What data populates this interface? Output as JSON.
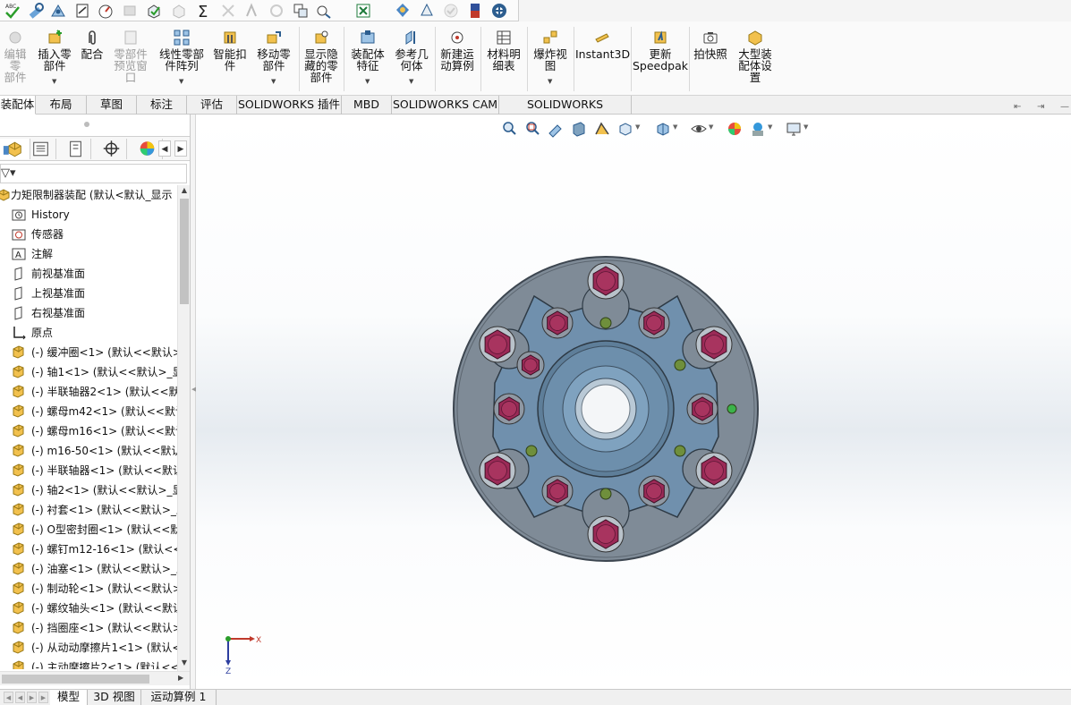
{
  "quick_access": {
    "icons": [
      "spell-check-icon",
      "measure-icon",
      "mass-properties-icon",
      "section-icon",
      "performance-icon",
      "disabled-icon",
      "check-icon",
      "disabled-icon-2",
      "sum-icon",
      "disabled-icon-3",
      "disabled-icon-4",
      "disabled-icon-5",
      "replace-icon",
      "sensor-icon",
      "excel-icon",
      "render-icon",
      "render-icon-2",
      "disabled-check-icon",
      "material-icon",
      "options-icon"
    ]
  },
  "ribbon": {
    "buttons": [
      {
        "id": "edit-component",
        "label": "编辑零\n部件",
        "disabled": true
      },
      {
        "id": "insert-component",
        "label": "插入零\n部件",
        "dropdown": true
      },
      {
        "id": "mate",
        "label": "配合"
      },
      {
        "id": "component-preview",
        "label": "零部件\n预览窗\n口",
        "disabled": true
      },
      {
        "id": "linear-pattern",
        "label": "线性零部\n件阵列",
        "dropdown": true
      },
      {
        "id": "smart-fastener",
        "label": "智能扣\n件"
      },
      {
        "id": "move-component",
        "label": "移动零\n部件",
        "dropdown": true
      },
      {
        "id": "show-hidden",
        "label": "显示隐\n藏的零\n部件"
      },
      {
        "id": "assembly-feature",
        "label": "装配体\n特征",
        "dropdown": true
      },
      {
        "id": "reference-geometry",
        "label": "参考几\n何体",
        "dropdown": true
      },
      {
        "id": "new-motion-study",
        "label": "新建运\n动算例"
      },
      {
        "id": "bom",
        "label": "材料明\n细表"
      },
      {
        "id": "exploded-view",
        "label": "爆炸视\n图",
        "dropdown": true
      },
      {
        "id": "instant3d",
        "label": "Instant3D"
      },
      {
        "id": "update-speedpak",
        "label": "更新\nSpeedpak"
      },
      {
        "id": "snapshot",
        "label": "拍快照"
      },
      {
        "id": "large-assembly",
        "label": "大型装\n配体设\n置"
      }
    ]
  },
  "tabs": [
    "装配体",
    "布局",
    "草图",
    "标注",
    "评估",
    "SOLIDWORKS 插件",
    "MBD",
    "SOLIDWORKS CAM",
    "SOLIDWORKS Inspection"
  ],
  "active_tab": "装配体",
  "feature_manager": {
    "panel_tabs": [
      "feature-manager-tab",
      "property-manager-tab",
      "configuration-manager-tab",
      "dimxpert-tab",
      "display-manager-tab"
    ],
    "filter_glyph": "▽▾",
    "tree": [
      {
        "label": "力矩限制器装配  (默认<默认_显示",
        "icon": "assembly-icon",
        "root": true
      },
      {
        "label": "History",
        "icon": "history-icon"
      },
      {
        "label": "传感器",
        "icon": "sensor-folder-icon"
      },
      {
        "label": "注解",
        "icon": "annotation-icon"
      },
      {
        "label": "前视基准面",
        "icon": "plane-icon"
      },
      {
        "label": "上视基准面",
        "icon": "plane-icon"
      },
      {
        "label": "右视基准面",
        "icon": "plane-icon"
      },
      {
        "label": "原点",
        "icon": "origin-icon"
      },
      {
        "label": "(-) 缓冲圈<1> (默认<<默认>",
        "icon": "part-icon"
      },
      {
        "label": "(-) 轴1<1> (默认<<默认>_显",
        "icon": "part-icon"
      },
      {
        "label": "(-) 半联轴器2<1> (默认<<默",
        "icon": "part-icon"
      },
      {
        "label": "(-) 螺母m42<1> (默认<<默认",
        "icon": "part-icon"
      },
      {
        "label": "(-) 螺母m16<1> (默认<<默认",
        "icon": "part-icon"
      },
      {
        "label": "(-) m16-50<1> (默认<<默认",
        "icon": "part-icon"
      },
      {
        "label": "(-) 半联轴器<1> (默认<<默认",
        "icon": "part-icon"
      },
      {
        "label": "(-) 轴2<1> (默认<<默认>_显",
        "icon": "part-icon"
      },
      {
        "label": "(-) 衬套<1> (默认<<默认>_显",
        "icon": "part-icon"
      },
      {
        "label": "(-) O型密封圈<1> (默认<<默",
        "icon": "part-icon"
      },
      {
        "label": "(-) 螺钉m12-16<1> (默认<<",
        "icon": "part-icon"
      },
      {
        "label": "(-) 油塞<1> (默认<<默认>_显",
        "icon": "part-icon"
      },
      {
        "label": "(-) 制动轮<1> (默认<<默认>",
        "icon": "part-icon"
      },
      {
        "label": "(-) 螺纹轴头<1> (默认<<默认",
        "icon": "part-icon"
      },
      {
        "label": "(-) 挡圈座<1> (默认<<默认>",
        "icon": "part-icon"
      },
      {
        "label": "(-) 从动动摩擦片1<1> (默认<",
        "icon": "part-icon"
      },
      {
        "label": "(-) 主动摩擦片2<1> (默认<<",
        "icon": "part-icon"
      }
    ]
  },
  "graphics": {
    "heads_up_toolbar": [
      "zoom-to-fit-icon",
      "zoom-to-area-icon",
      "previous-view-icon",
      "section-view-icon",
      "dynamic-annotation-icon",
      "view-orientation-icon",
      "display-style-icon",
      "hide-show-icon",
      "edit-appearance-icon",
      "apply-scene-icon",
      "view-settings-icon"
    ],
    "triad": {
      "x_label": "X",
      "z_label": "Z"
    },
    "colors": {
      "flange": "#7d8a96",
      "hub": "#5f7f9a",
      "bolt": "#9b2a57",
      "pin": "#6b8a3a"
    }
  },
  "bottom_tabs": [
    "模型",
    "3D 视图",
    "运动算例 1"
  ],
  "active_bottom_tab": "模型"
}
